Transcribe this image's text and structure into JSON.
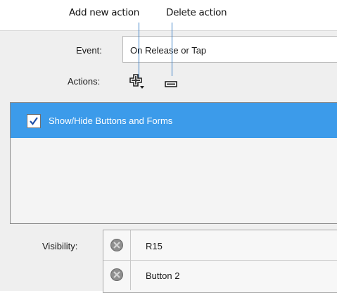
{
  "callouts": {
    "add": "Add new action",
    "delete": "Delete action"
  },
  "event": {
    "label": "Event:",
    "value": "On Release or Tap"
  },
  "actions": {
    "label": "Actions:",
    "add_icon": "add-action-icon",
    "delete_icon": "delete-action-icon",
    "items": [
      {
        "label": "Show/Hide Buttons and Forms",
        "checked": true,
        "selected": true
      }
    ]
  },
  "visibility": {
    "label": "Visibility:",
    "items": [
      {
        "name": "R15",
        "state_icon": "hidden-state-icon"
      },
      {
        "name": "Button 2",
        "state_icon": "hidden-state-icon"
      }
    ]
  },
  "colors": {
    "selection": "#3c9bea",
    "callout_line": "#3c7fc6",
    "panel": "#efefef"
  }
}
